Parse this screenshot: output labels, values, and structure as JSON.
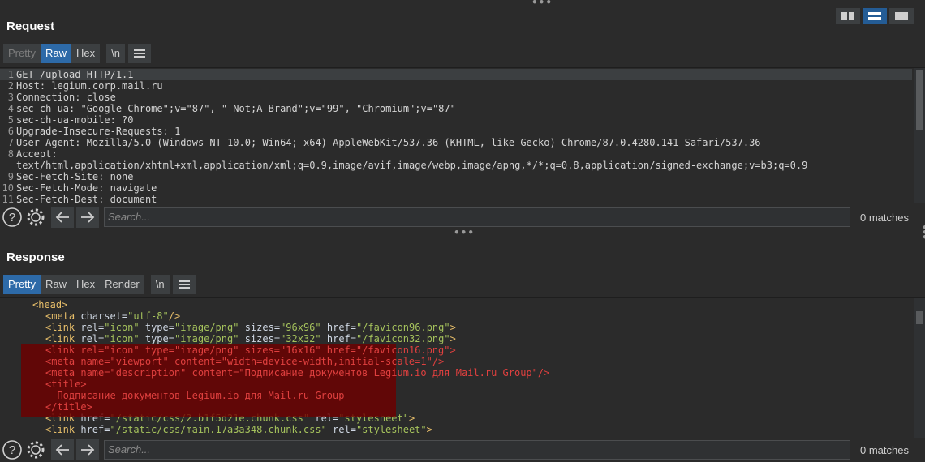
{
  "request": {
    "title": "Request",
    "tabs": [
      "Pretty",
      "Raw",
      "Hex",
      "\\n"
    ],
    "lines": [
      {
        "n": "1",
        "t": "GET /upload HTTP/1.1"
      },
      {
        "n": "2",
        "t": "Host: legium.corp.mail.ru"
      },
      {
        "n": "3",
        "t": "Connection: close"
      },
      {
        "n": "4",
        "t": "sec-ch-ua: \"Google Chrome\";v=\"87\", \" Not;A Brand\";v=\"99\", \"Chromium\";v=\"87\""
      },
      {
        "n": "5",
        "t": "sec-ch-ua-mobile: ?0"
      },
      {
        "n": "6",
        "t": "Upgrade-Insecure-Requests: 1"
      },
      {
        "n": "7",
        "t": "User-Agent: Mozilla/5.0 (Windows NT 10.0; Win64; x64) AppleWebKit/537.36 (KHTML, like Gecko) Chrome/87.0.4280.141 Safari/537.36"
      },
      {
        "n": "8",
        "t": "Accept:"
      },
      {
        "n": "",
        "t": "text/html,application/xhtml+xml,application/xml;q=0.9,image/avif,image/webp,image/apng,*/*;q=0.8,application/signed-exchange;v=b3;q=0.9"
      },
      {
        "n": "9",
        "t": "Sec-Fetch-Site: none"
      },
      {
        "n": "10",
        "t": "Sec-Fetch-Mode: navigate"
      },
      {
        "n": "11",
        "t": "Sec-Fetch-Dest: document"
      }
    ],
    "search_placeholder": "Search...",
    "matches": "0 matches"
  },
  "response": {
    "title": "Response",
    "tabs": [
      "Pretty",
      "Raw",
      "Hex",
      "Render",
      "\\n"
    ],
    "search_placeholder": "Search...",
    "matches": "0 matches",
    "code": {
      "head_open": "<head>",
      "meta_charset": [
        "<meta",
        "charset=",
        "\"utf-8\"",
        "/>"
      ],
      "link96": [
        "<link",
        "rel=",
        "\"icon\"",
        "type=",
        "\"image/png\"",
        "sizes=",
        "\"96x96\"",
        "href=",
        "\"/favicon96.png\"",
        ">"
      ],
      "link32": [
        "<link",
        "rel=",
        "\"icon\"",
        "type=",
        "\"image/png\"",
        "sizes=",
        "\"32x32\"",
        "href=",
        "\"/favicon32.png\"",
        ">"
      ],
      "link16": "<link rel=\"icon\" type=\"image/png\" sizes=\"16x16\" href=\"/favicon16.png\">",
      "viewport": "<meta name=\"viewport\" content=\"width=device-width,initial-scale=1\"/>",
      "description": "<meta name=\"description\" content=\"Подписание документов Legium.io для Mail.ru Group\"/>",
      "title_open": "<title>",
      "title_text": "  Подписание документов Legium.io для Mail.ru Group",
      "title_close": "</title>",
      "css2": [
        "<link",
        "href=",
        "\"/static/css/2.b1f5d21e.chunk.css\"",
        "rel=",
        "\"stylesheet\"",
        ">"
      ],
      "cssmain": [
        "<link",
        "href=",
        "\"/static/css/main.17a3a348.chunk.css\"",
        "rel=",
        "\"stylesheet\"",
        ">"
      ]
    }
  }
}
